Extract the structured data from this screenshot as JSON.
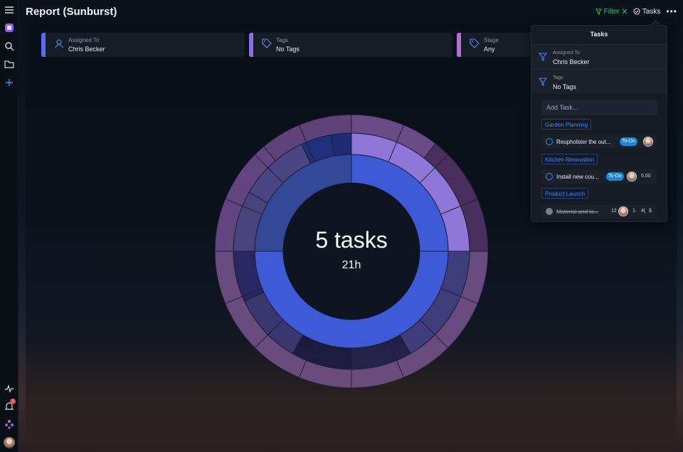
{
  "header": {
    "title": "Report (Sunburst)",
    "filter_label": "Filter",
    "tasks_label": "Tasks",
    "more_label": "•••"
  },
  "rail": {
    "icons": [
      "menu-icon",
      "app-logo-icon",
      "search-icon",
      "folder-icon",
      "plus-icon",
      "activity-icon",
      "bell-icon",
      "apps-icon",
      "user-avatar"
    ],
    "notification_count": "1"
  },
  "filters": [
    {
      "label": "Assigned To",
      "value": "Chris Becker",
      "icon": "user-icon",
      "color": "#5b6cf0"
    },
    {
      "label": "Tags",
      "value": "No Tags",
      "icon": "tag-icon",
      "color": "#8a6fe0"
    },
    {
      "label": "Stage",
      "value": "Any",
      "icon": "tag-icon",
      "color": "#b46fd6"
    }
  ],
  "chart_data": {
    "type": "sunburst",
    "center_label": "5 tasks",
    "center_sublabel": "21h"
  },
  "dropdown": {
    "title": "Tasks",
    "filters": [
      {
        "label": "Assigned To",
        "value": "Chris Becker"
      },
      {
        "label": "Tags",
        "value": "No Tags"
      }
    ],
    "add_placeholder": "Add Task...",
    "projects": [
      {
        "name": "Garden Planning",
        "task": "Reupholster the out...",
        "status": "To-Do"
      },
      {
        "name": "Kitchen Renovation",
        "task": "Install new cou...",
        "status": "To-Do",
        "value": "5.00"
      },
      {
        "name": "Product Launch",
        "task": "Material and la...",
        "meta1": "12",
        "meta2": "1·",
        "meta3": "4(",
        "meta4": "$"
      }
    ]
  },
  "colors": {
    "accent": "#3b5bdb",
    "filter_green": "#3fc46b",
    "status_blue": "#1b86d6"
  }
}
